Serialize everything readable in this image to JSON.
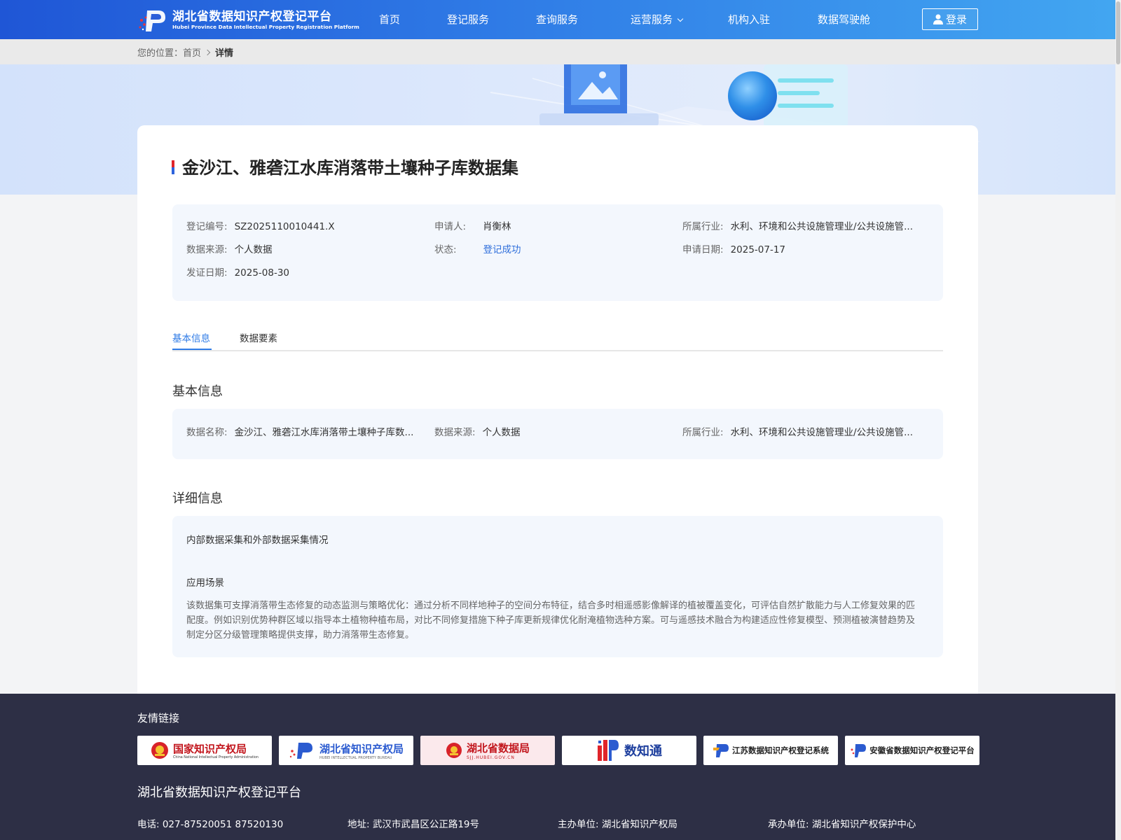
{
  "header": {
    "logo_cn": "湖北省数据知识产权登记平台",
    "logo_en": "Hubei Province Data Intellectual Property Registration Platform",
    "nav": [
      "首页",
      "登记服务",
      "查询服务",
      "运营服务",
      "机构入驻",
      "数据驾驶舱"
    ],
    "login_label": "登录"
  },
  "breadcrumb": {
    "prefix": "您的位置：",
    "home": "首页",
    "current": "详情"
  },
  "record": {
    "title": "金沙江、雅砻江水库消落带土壤种子库数据集",
    "fields": {
      "reg_no_label": "登记编号:",
      "reg_no": "SZ2025110010441.X",
      "applicant_label": "申请人:",
      "applicant": "肖衡林",
      "industry_label": "所属行业:",
      "industry": "水利、环境和公共设施管理业/公共设施管...",
      "source_label": "数据来源:",
      "source": "个人数据",
      "status_label": "状态:",
      "status": "登记成功",
      "apply_date_label": "申请日期:",
      "apply_date": "2025-07-17",
      "issue_date_label": "发证日期:",
      "issue_date": "2025-08-30"
    }
  },
  "tabs": [
    "基本信息",
    "数据要素"
  ],
  "basic": {
    "section_title": "基本信息",
    "name_label": "数据名称:",
    "name": "金沙江、雅砻江水库消落带土壤种子库数...",
    "source_label": "数据来源:",
    "source": "个人数据",
    "industry_label": "所属行业:",
    "industry": "水利、环境和公共设施管理业/公共设施管..."
  },
  "detail": {
    "section_title": "详细信息",
    "collection_label": "内部数据采集和外部数据采集情况",
    "scenario_label": "应用场景",
    "scenario_text": "该数据集可支撑消落带生态修复的动态监测与策略优化：通过分析不同样地种子的空间分布特征，结合多时相遥感影像解译的植被覆盖变化，可评估自然扩散能力与人工修复效果的匹配度。例如识别优势种群区域以指导本土植物种植布局，对比不同修复措施下种子库更新规律优化耐淹植物选种方案。可与遥感技术融合为构建适应性修复模型、预测植被演替趋势及制定分区分级管理策略提供支撑，助力消落带生态修复。"
  },
  "footer": {
    "links_title": "友情链接",
    "links": [
      {
        "cn": "国家知识产权局",
        "en": "China National Intellectual Property Administration"
      },
      {
        "cn": "湖北省知识产权局",
        "en": "HUBEI INTELLECTUAL PROPERTY BUREAU"
      },
      {
        "cn": "湖北省数据局",
        "en": "SJJ.HUBEI.GOV.CN"
      },
      {
        "cn": "数知通",
        "en": ""
      },
      {
        "cn": "江苏数据知识产权登记系统",
        "en": ""
      },
      {
        "cn": "安徽省数据知识产权登记平台",
        "en": ""
      }
    ],
    "platform_name": "湖北省数据知识产权登记平台",
    "phone": "电话: 027-87520051 87520130",
    "address": "地址: 武汉市武昌区公正路19号",
    "host": "主办单位: 湖北省知识产权局",
    "organizer": "承办单位: 湖北省知识产权保护中心"
  },
  "colors": {
    "header_start": "#1f56d6",
    "header_end": "#42a6f1",
    "accent": "#2f7be6",
    "status_success": "#2f6fdb",
    "footer_bg": "#2d2f45"
  }
}
